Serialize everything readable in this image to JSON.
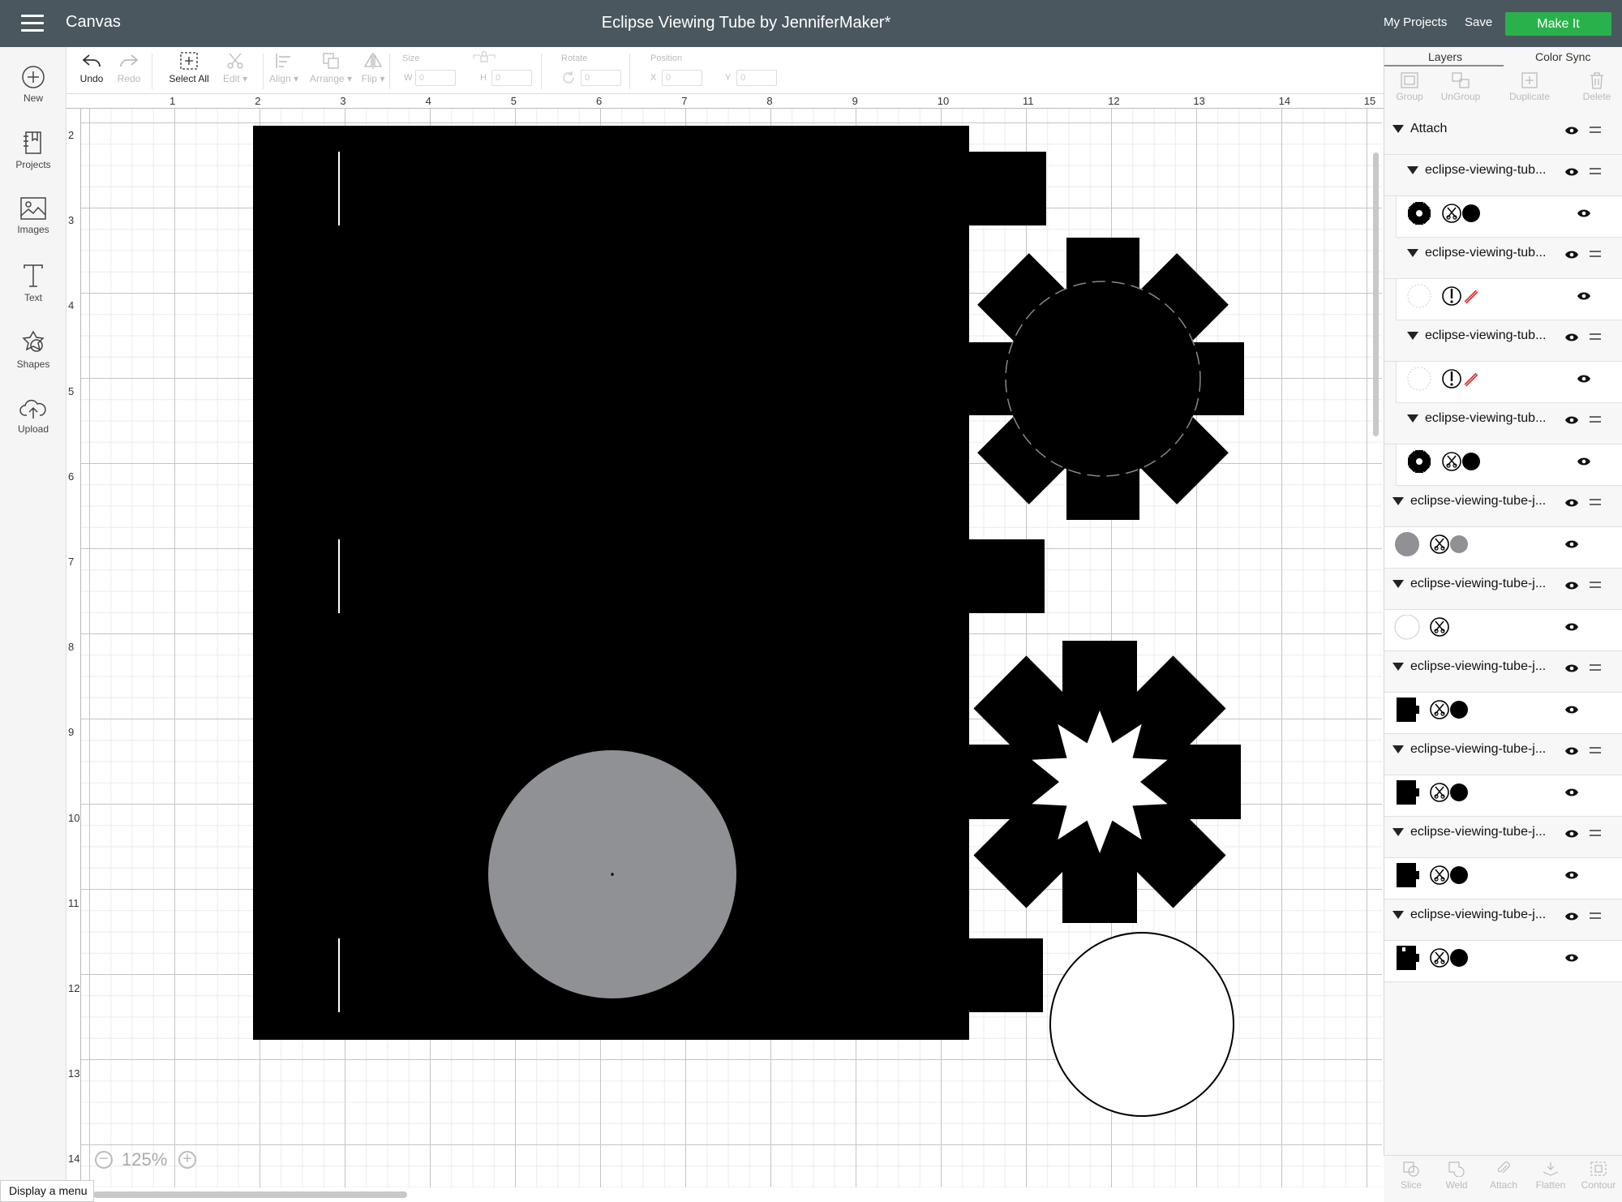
{
  "header": {
    "app_name": "Canvas",
    "project_title": "Eclipse Viewing Tube by JenniferMaker*",
    "my_projects": "My Projects",
    "save": "Save",
    "make_it": "Make It"
  },
  "sidebar": {
    "items": [
      {
        "label": "New",
        "icon": "plus-circle-icon"
      },
      {
        "label": "Projects",
        "icon": "projects-icon"
      },
      {
        "label": "Images",
        "icon": "images-icon"
      },
      {
        "label": "Text",
        "icon": "text-icon"
      },
      {
        "label": "Shapes",
        "icon": "shapes-icon"
      },
      {
        "label": "Upload",
        "icon": "upload-cloud-icon"
      }
    ]
  },
  "toolbar": {
    "undo": "Undo",
    "redo": "Redo",
    "select_all": "Select All",
    "edit": "Edit",
    "align": "Align",
    "arrange": "Arrange",
    "flip": "Flip",
    "size_label": "Size",
    "w": "W",
    "w_value": "0",
    "h": "H",
    "h_value": "0",
    "rotate_label": "Rotate",
    "rotate_value": "0",
    "position_label": "Position",
    "x": "X",
    "x_value": "0",
    "y": "Y",
    "y_value": "0"
  },
  "ruler": {
    "horizontal": [
      "1",
      "2",
      "3",
      "4",
      "5",
      "6",
      "7",
      "8",
      "9",
      "10",
      "11",
      "12",
      "13",
      "14",
      "15"
    ],
    "vertical": [
      "2",
      "3",
      "4",
      "5",
      "6",
      "7",
      "8",
      "9",
      "10",
      "11",
      "12",
      "13",
      "14"
    ]
  },
  "zoom": {
    "value": "125%",
    "minus": "−",
    "plus": "+"
  },
  "display_menu": "Display a menu",
  "panel": {
    "tabs": [
      "Layers",
      "Color Sync"
    ],
    "tools": [
      "Group",
      "UnGroup",
      "Duplicate",
      "Delete"
    ],
    "bottom_tools": [
      "Slice",
      "Weld",
      "Attach",
      "Flatten",
      "Contour"
    ],
    "attach_label": "Attach",
    "layers": [
      {
        "name": "eclipse-viewing-tub...",
        "thumb": "gear-black",
        "dot": "#000000"
      },
      {
        "name": "eclipse-viewing-tub...",
        "thumb": "dashed-circle",
        "dot": "none"
      },
      {
        "name": "eclipse-viewing-tub...",
        "thumb": "dashed-circle",
        "dot": "none"
      },
      {
        "name": "eclipse-viewing-tub...",
        "thumb": "gear-black",
        "dot": "#000000"
      },
      {
        "name": "eclipse-viewing-tube-j...",
        "thumb": "circle-gray",
        "dot": "#8f9194"
      },
      {
        "name": "eclipse-viewing-tube-j...",
        "thumb": "circle-white",
        "dot": "#ffffff"
      },
      {
        "name": "eclipse-viewing-tube-j...",
        "thumb": "rect-black",
        "dot": "#000000"
      },
      {
        "name": "eclipse-viewing-tube-j...",
        "thumb": "rect-black",
        "dot": "#000000"
      },
      {
        "name": "eclipse-viewing-tube-j...",
        "thumb": "rect-black",
        "dot": "#000000"
      },
      {
        "name": "eclipse-viewing-tube-j...",
        "thumb": "rect-black-notch",
        "dot": "#000000"
      }
    ]
  },
  "colors": {
    "topbar": "#4b575f",
    "make_it": "#29b24b",
    "gray_circle": "#8f9194"
  }
}
